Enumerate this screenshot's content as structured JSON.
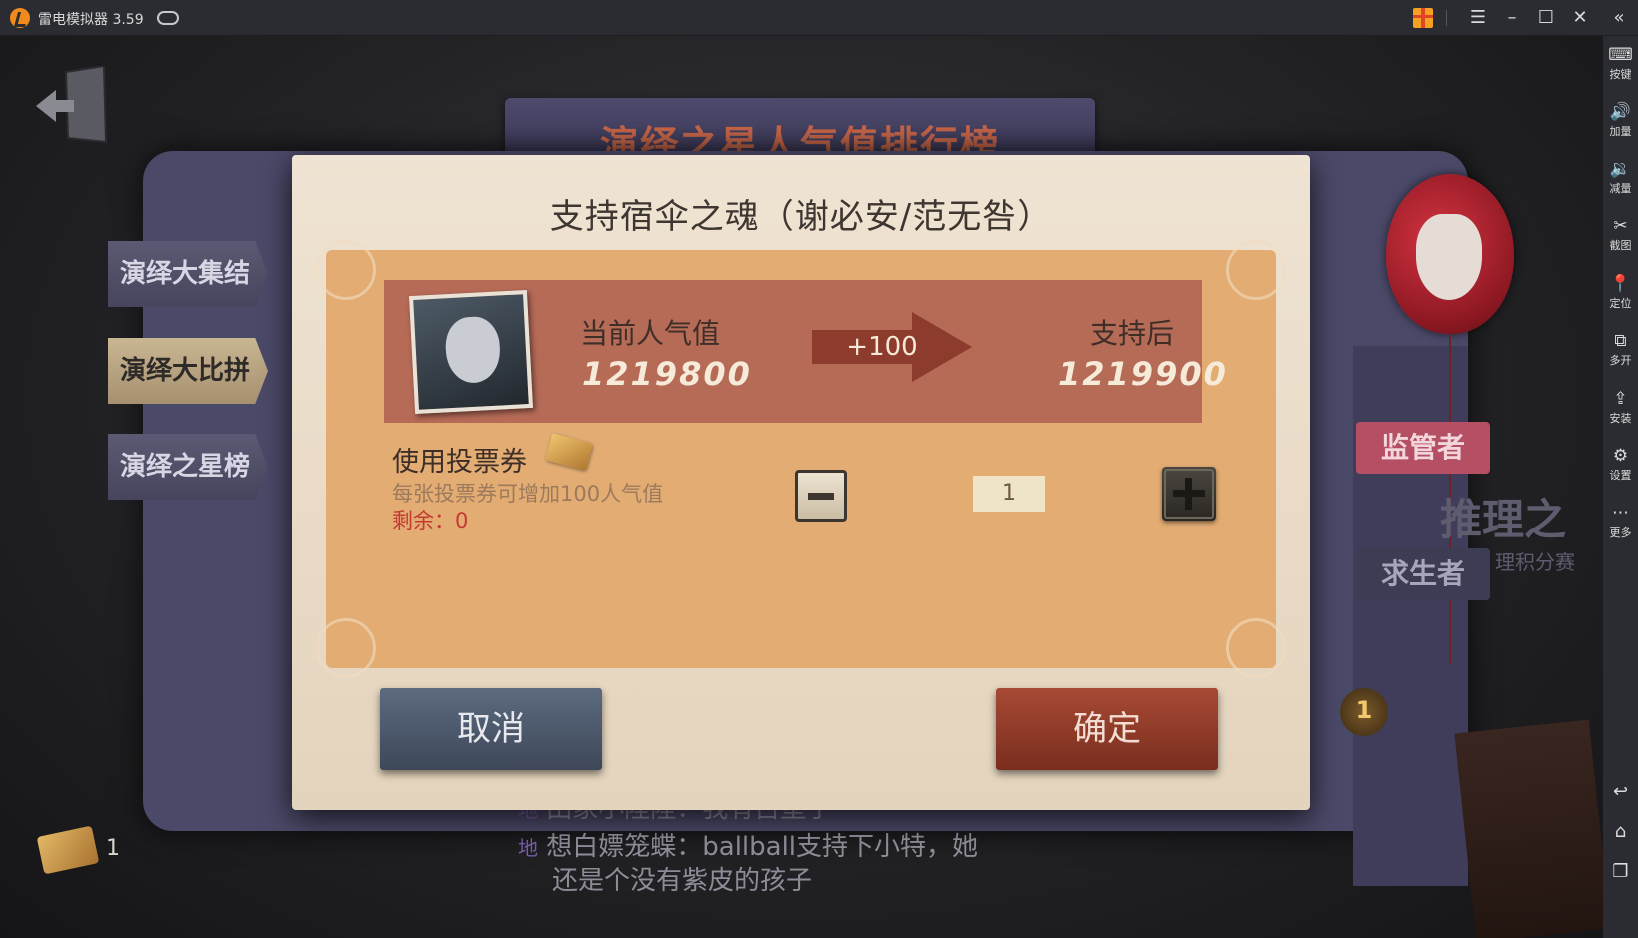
{
  "emulator": {
    "app_name": "雷电模拟器 3.59",
    "window_buttons": {
      "menu": "☰",
      "minimize": "–",
      "maximize": "☐",
      "close": "✕",
      "collapse": "«"
    },
    "sidebar": [
      {
        "icon": "⌨",
        "label": "按键"
      },
      {
        "icon": "🔊",
        "label": "加量"
      },
      {
        "icon": "🔉",
        "label": "减量"
      },
      {
        "icon": "✂",
        "label": "截图"
      },
      {
        "icon": "📍",
        "label": "定位"
      },
      {
        "icon": "⧉",
        "label": "多开"
      },
      {
        "icon": "⇪",
        "label": "安装"
      },
      {
        "icon": "⚙",
        "label": "设置"
      },
      {
        "icon": "⋯",
        "label": "更多"
      }
    ],
    "sidebar_bottom": {
      "back": "↩",
      "home": "⌂",
      "recent": "❐"
    }
  },
  "game": {
    "banner_title": "演绎之星人气值排行榜",
    "side_tabs": [
      "演绎大集结",
      "演绎大比拼",
      "演绎之星榜"
    ],
    "role_tabs": {
      "hunter": "监管者",
      "survivor": "求生者"
    },
    "faded_heading": "推理之",
    "faded_sub": "理积分赛",
    "crown_rank": "1",
    "chat": [
      {
        "tag": "地",
        "text": "田家小陸陸：我有古堡了"
      },
      {
        "tag": "地",
        "text": "想白嫖笼蝶：ballball支持下小特，她"
      },
      {
        "tag": "",
        "text": "还是个没有紫皮的孩子"
      }
    ],
    "ticket_count": "1"
  },
  "dialog": {
    "title": "支持宿伞之魂（谢必安/范无咎）",
    "current_label": "当前人气值",
    "current_value": "1219800",
    "increment": "+100",
    "after_label": "支持后",
    "after_value": "1219900",
    "use_ticket_label": "使用投票券",
    "description": "每张投票券可增加100人气值",
    "remaining": "剩余：0",
    "quantity": "1",
    "cancel_label": "取消",
    "confirm_label": "确定"
  }
}
